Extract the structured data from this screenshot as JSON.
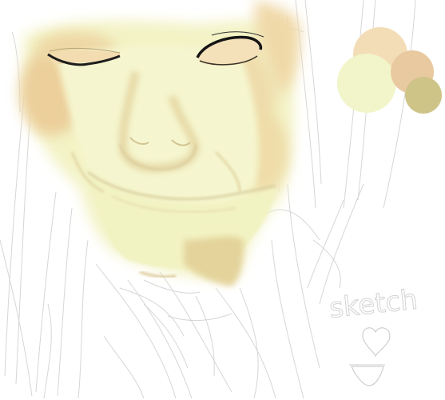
{
  "canvas": {
    "background": "#ffffff",
    "sketch_word": "sketch"
  },
  "palette": {
    "swatches": [
      {
        "name": "light-peach",
        "color": "#f3ddb6"
      },
      {
        "name": "pale-green-yellow",
        "color": "#f1f5c9"
      },
      {
        "name": "tan",
        "color": "#e9c9a0"
      },
      {
        "name": "olive-khaki",
        "color": "#cfc487"
      }
    ]
  },
  "colors": {
    "skin_base": "#f3f3c6",
    "skin_warm": "#eed39f",
    "skin_shadow": "#e2d29c",
    "sketch_line": "#d4d4d4",
    "eye_line": "#222222"
  }
}
